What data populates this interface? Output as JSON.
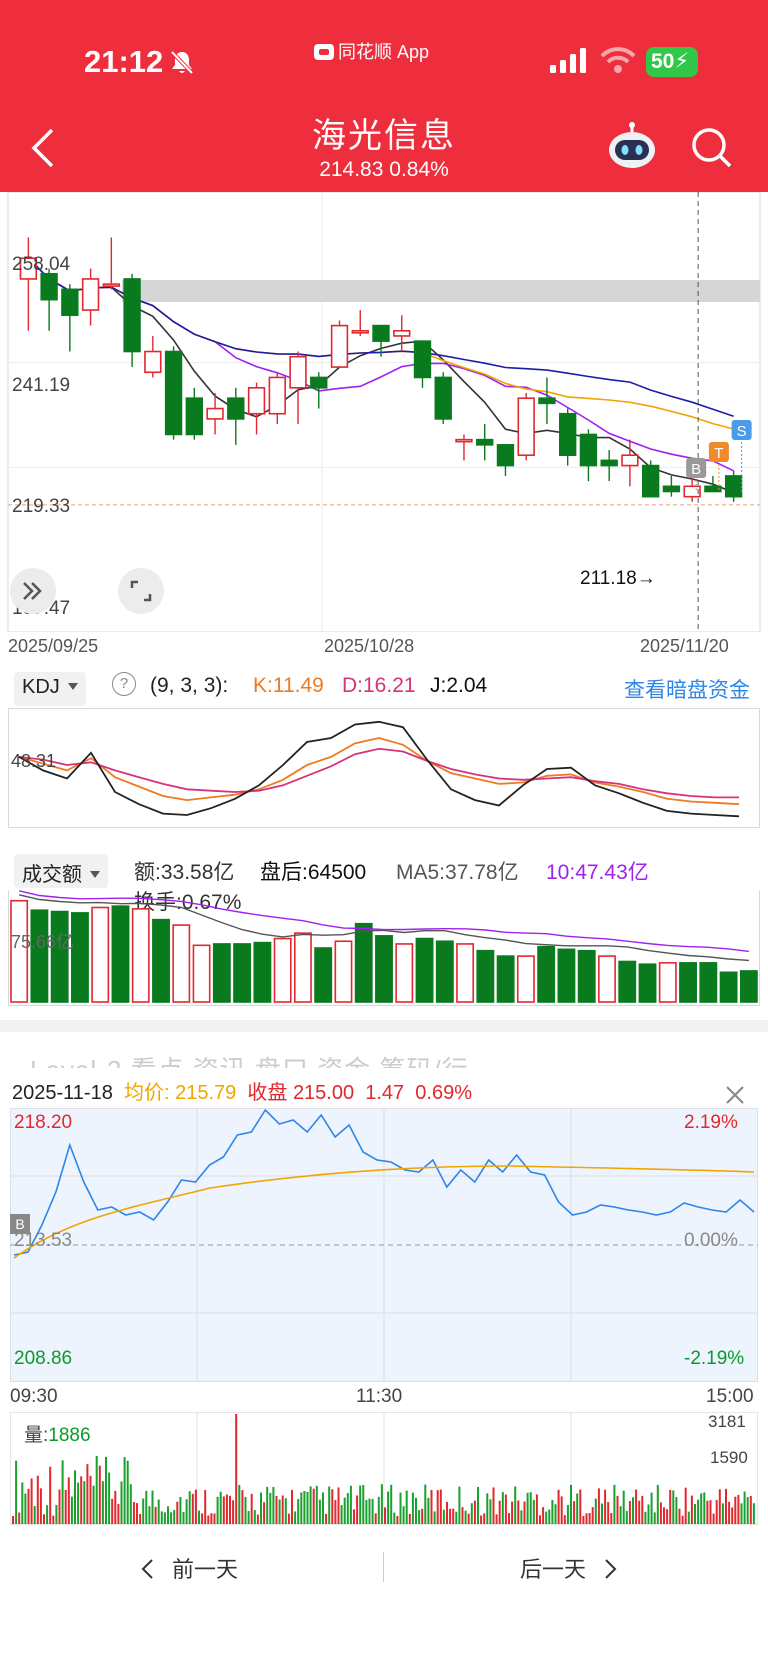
{
  "status": {
    "time": "21:12",
    "app": "同花顺 App",
    "battery": "50"
  },
  "stock": {
    "name": "海光信息",
    "price": "214.83",
    "change_pct": "0.84%"
  },
  "kchart": {
    "y_labels": [
      "258.04",
      "241.19",
      "219.33",
      "197.47"
    ],
    "dates": [
      "2025/09/25",
      "2025/10/28",
      "2025/11/20"
    ],
    "low_marker": "211.18→",
    "badges": [
      "B",
      "T",
      "S"
    ]
  },
  "kdj": {
    "selector": "KDJ",
    "params": "(9, 3, 3):",
    "k": "K:11.49",
    "d": "D:16.21",
    "j": "J:2.04",
    "link": "查看暗盘资金",
    "axis_label": "48.31"
  },
  "volume": {
    "selector": "成交额",
    "amount": "额:33.58亿",
    "after_hours": "盘后:64500",
    "ma5": "MA5:37.78亿",
    "ma10": "10:47.43亿",
    "turnover": "换手:0.67%",
    "axis_label": "75.66亿"
  },
  "ghost_tabs": "Level-2   看点   资讯   盘口   资金   筹码/行",
  "intraday": {
    "date": "2025-11-18",
    "avg_label": "均价:",
    "avg": "215.79",
    "close_label": "收盘",
    "close": "215.00",
    "change": "1.47",
    "change_pct": "0.69%",
    "high": "218.20",
    "mid": "213.53",
    "low": "208.86",
    "pct_high": "2.19%",
    "pct_mid": "0.00%",
    "pct_low": "-2.19%",
    "times": [
      "09:30",
      "11:30",
      "15:00"
    ],
    "vol_label": "量:",
    "vol_value": "1886",
    "vol_max": "3181",
    "vol_mid": "1590",
    "badge": "B"
  },
  "nav": {
    "prev": "前一天",
    "next": "后一天"
  },
  "colors": {
    "up": "#e0282e",
    "down": "#0a7a1f",
    "accent": "#ee2e3c",
    "blue_link": "#2f86e8"
  },
  "chart_data": [
    {
      "type": "candlestick",
      "title": "",
      "ylim": [
        197.47,
        258.04
      ],
      "x_start": "2025/09/25",
      "x_end": "2025/11/20",
      "candles": [
        [
          254,
          258,
          247,
          262,
          244
        ],
        [
          255,
          250,
          251,
          256,
          244
        ],
        [
          252,
          247,
          248,
          253,
          240
        ],
        [
          248,
          254,
          250,
          256,
          245
        ],
        [
          253,
          253,
          254,
          262,
          252
        ],
        [
          254,
          240,
          241,
          255,
          237
        ],
        [
          236,
          240,
          239,
          243,
          235
        ],
        [
          240,
          224,
          225,
          241,
          223
        ],
        [
          231,
          224,
          226,
          233,
          223
        ],
        [
          227,
          229,
          227,
          232,
          224
        ],
        [
          231,
          227,
          229,
          233,
          222
        ],
        [
          228,
          233,
          229,
          234,
          224
        ],
        [
          228,
          235,
          229,
          236,
          226
        ],
        [
          233,
          239,
          234,
          240,
          226
        ],
        [
          235,
          233,
          234,
          236,
          229
        ],
        [
          237,
          245,
          240,
          246,
          238
        ],
        [
          244,
          244,
          245,
          248,
          243
        ],
        [
          245,
          242,
          243,
          245,
          239
        ],
        [
          243,
          244,
          243,
          247,
          240
        ],
        [
          242,
          235,
          237,
          242,
          233
        ],
        [
          235,
          227,
          229,
          236,
          226
        ],
        [
          223,
          223,
          224,
          224,
          219
        ],
        [
          223,
          222,
          221,
          226,
          219
        ],
        [
          222,
          218,
          219,
          222,
          216
        ],
        [
          220,
          231,
          230,
          232,
          219
        ],
        [
          231,
          230,
          228,
          235,
          226
        ],
        [
          228,
          220,
          222,
          229,
          218
        ],
        [
          224,
          218,
          220,
          225,
          215
        ],
        [
          219,
          218,
          219,
          221,
          215
        ],
        [
          218,
          220,
          221,
          223,
          214
        ],
        [
          218,
          212,
          213,
          219,
          212
        ],
        [
          214,
          213,
          212,
          216,
          212
        ],
        [
          212,
          214,
          213,
          217,
          211
        ],
        [
          214,
          213,
          212,
          216,
          213
        ],
        [
          216,
          212,
          213,
          217,
          211
        ]
      ],
      "ma_series": [
        {
          "name": "MA5",
          "color": "#333"
        },
        {
          "name": "MA10",
          "color": "#a020f0"
        },
        {
          "name": "MA20",
          "color": "#f0a500"
        },
        {
          "name": "MA30",
          "color": "#1c1ca8"
        }
      ]
    },
    {
      "type": "line",
      "title": "KDJ",
      "series": [
        {
          "name": "K",
          "values": [
            46,
            41,
            36,
            45,
            31,
            24,
            17,
            14,
            16,
            18,
            22,
            29,
            40,
            46,
            56,
            60,
            55,
            43,
            34,
            30,
            26,
            27,
            32,
            33,
            27,
            24,
            20,
            15,
            13,
            12,
            11
          ]
        },
        {
          "name": "D",
          "values": [
            46,
            44,
            40,
            42,
            36,
            31,
            26,
            22,
            21,
            20,
            21,
            25,
            32,
            39,
            48,
            52,
            50,
            43,
            37,
            33,
            30,
            29,
            30,
            31,
            28,
            26,
            22,
            19,
            17,
            16,
            16
          ]
        },
        {
          "name": "J",
          "values": [
            46,
            36,
            30,
            49,
            20,
            11,
            4,
            3,
            8,
            15,
            25,
            40,
            57,
            60,
            70,
            72,
            68,
            44,
            22,
            14,
            10,
            25,
            37,
            38,
            25,
            19,
            12,
            6,
            4,
            3,
            2
          ]
        }
      ]
    },
    {
      "type": "bar",
      "title": "成交额",
      "values": [
        75,
        68,
        67,
        66,
        70,
        71,
        69,
        61,
        57,
        42,
        43,
        43,
        44,
        47,
        51,
        40,
        45,
        58,
        49,
        43,
        47,
        45,
        43,
        38,
        34,
        34,
        41,
        39,
        38,
        34,
        30,
        28,
        29,
        29,
        29,
        22,
        23
      ],
      "up": [
        1,
        0,
        0,
        0,
        1,
        0,
        1,
        0,
        1,
        1,
        0,
        0,
        0,
        1,
        1,
        0,
        1,
        0,
        0,
        1,
        0,
        0,
        1,
        0,
        0,
        1,
        0,
        0,
        0,
        1,
        0,
        0,
        1,
        0,
        0,
        0,
        0
      ]
    }
  ]
}
